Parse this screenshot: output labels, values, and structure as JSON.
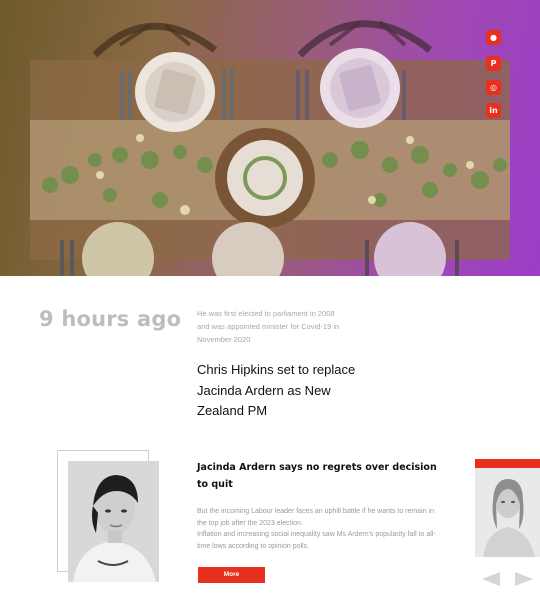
{
  "social": {
    "icons": [
      {
        "name": "spotify",
        "glyph": "●"
      },
      {
        "name": "pinterest",
        "glyph": "P"
      },
      {
        "name": "dribbble",
        "glyph": "◎"
      },
      {
        "name": "linkedin",
        "glyph": "in"
      }
    ],
    "accent_color": "#e8301f"
  },
  "feature": {
    "time_ago": "9 hours ago",
    "note": "He was first elected to parliament in 2008 and was appointed minister for Covid-19 in November 2020",
    "headline": "Chris Hipkins set to replace Jacinda Ardern as New Zealand PM"
  },
  "story": {
    "title": "Jacinda Ardern says no regrets over decision to quit",
    "body_1": "But the incoming Labour leader faces an uphill battle if he wants to remain in the top job after the 2023 election.",
    "body_2": "Inflation and increasing social inequality saw Ms Ardern's popularity fall to all-time lows according to opinion polls.",
    "more_label": "More"
  },
  "nav": {
    "prev_icon": "arrow-left-icon",
    "next_icon": "arrow-right-icon"
  }
}
